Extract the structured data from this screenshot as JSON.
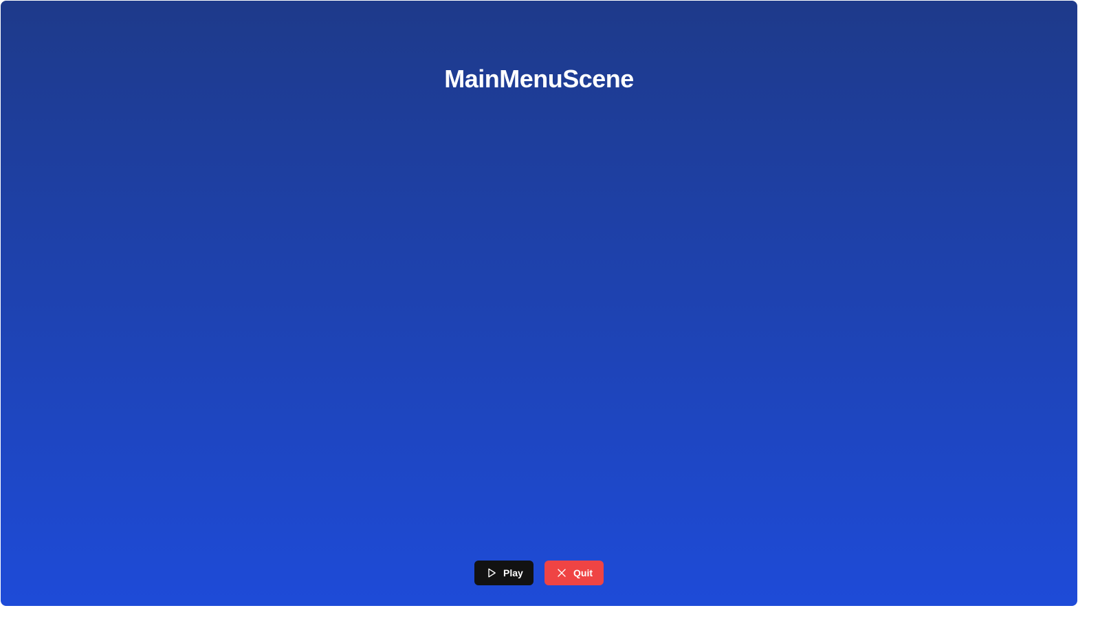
{
  "scene": {
    "title": "MainMenuScene"
  },
  "buttons": {
    "play": {
      "label": "Play",
      "icon": "play-icon"
    },
    "quit": {
      "label": "Quit",
      "icon": "close-icon"
    }
  },
  "colors": {
    "background_top": "#1e3a8a",
    "background_bottom": "#1e4bd8",
    "play_button": "#121212",
    "quit_button": "#ef4444",
    "text": "#ffffff"
  }
}
